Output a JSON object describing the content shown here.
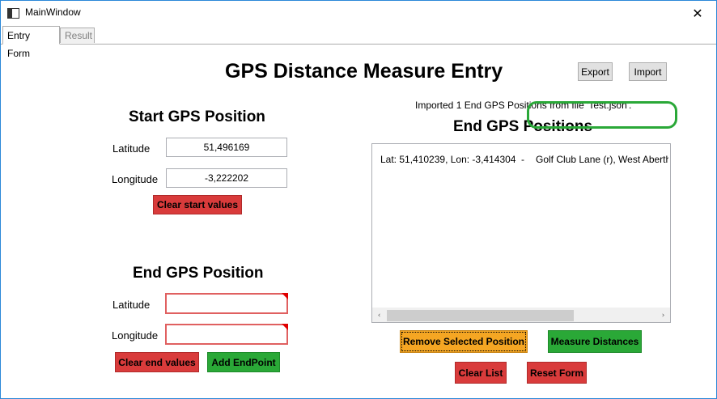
{
  "window": {
    "title": "MainWindow",
    "close_symbol": "✕"
  },
  "tabs": [
    {
      "label": "Entry Form",
      "active": true
    },
    {
      "label": "Result",
      "active": false
    }
  ],
  "header": {
    "title": "GPS Distance Measure Entry",
    "export_label": "Export",
    "import_label": "Import"
  },
  "start": {
    "heading": "Start GPS Position",
    "latitude_label": "Latitude",
    "latitude_value": "51,496169",
    "longitude_label": "Longitude",
    "longitude_value": "-3,222202",
    "clear_label": "Clear start values"
  },
  "end": {
    "heading": "End GPS Position",
    "latitude_label": "Latitude",
    "latitude_value": "",
    "longitude_label": "Longitude",
    "longitude_value": "",
    "clear_label": "Clear end values",
    "add_label": "Add EndPoint"
  },
  "end_list": {
    "status": "Imported 1 End GPS Positions from file 'Test.json'.",
    "heading": "End GPS Positions",
    "items": [
      {
        "coords": "Lat: 51,410239, Lon: -3,414304",
        "separator": "-",
        "place": "Golf Club Lane (r), West Aberthaw"
      }
    ],
    "scroll_left": "‹",
    "scroll_right": "›"
  },
  "actions": {
    "remove_label": "Remove Selected Position",
    "measure_label": "Measure Distances",
    "clear_list_label": "Clear List",
    "reset_label": "Reset Form"
  },
  "colors": {
    "red_button": "#d93b3b",
    "green_button": "#2aa837",
    "orange_button": "#f5a623",
    "highlight_ring": "#2aa838",
    "window_border": "#2b88d8"
  }
}
